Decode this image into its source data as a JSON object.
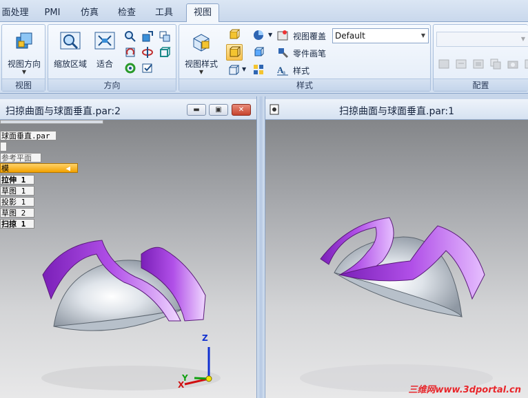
{
  "tabs": [
    {
      "label": "面处理",
      "active": false
    },
    {
      "label": "PMI",
      "active": false
    },
    {
      "label": "仿真",
      "active": false
    },
    {
      "label": "检查",
      "active": false
    },
    {
      "label": "工具",
      "active": false
    },
    {
      "label": "视图",
      "active": true
    }
  ],
  "ribbon": {
    "view_group": {
      "label": "视图",
      "view_orient_label": "视图方向"
    },
    "orient_group": {
      "label": "方向",
      "zoom_area_label": "缩放区域",
      "fit_label": "适合"
    },
    "style_group": {
      "label": "样式",
      "view_style_label": "视图样式",
      "view_overlay_label": "视图覆盖",
      "overlay_value": "Default",
      "part_painter_label": "零件画笔",
      "styles_label": "样式"
    },
    "config_group": {
      "label": "配置"
    }
  },
  "left_window": {
    "title": "扫掠曲面与球面垂直.par:2",
    "tree": [
      {
        "label": "球面垂直.par"
      },
      {
        "label": ""
      },
      {
        "label": "参考平面"
      },
      {
        "label": "模",
        "selected": true
      },
      {
        "label": "拉伸 1"
      },
      {
        "label": "草图 1"
      },
      {
        "label": "投影 1"
      },
      {
        "label": "草图 2"
      },
      {
        "label": "扫掠 1"
      }
    ],
    "axes": {
      "x": "X",
      "y": "Y",
      "z": "Z"
    }
  },
  "right_window": {
    "title": "扫掠曲面与球面垂直.par:1",
    "watermark": "三维网www.3dportal.cn"
  },
  "colors": {
    "surface_purple": "#a040d8",
    "body_grey": "#c8ced6",
    "selected_orange": "#f2a100",
    "close_red": "#c7452f"
  }
}
